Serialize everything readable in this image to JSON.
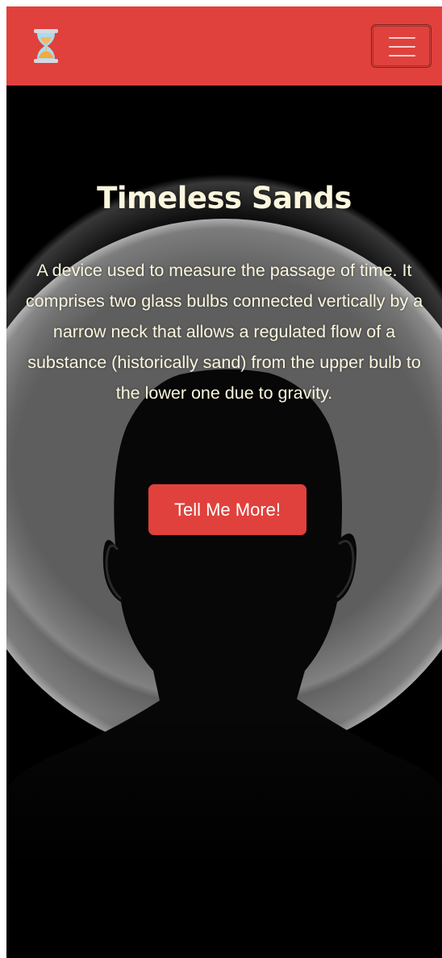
{
  "navbar": {
    "brand_icon": "hourglass-icon",
    "toggler_icon": "hamburger-menu-icon",
    "background_color": "#e0413c"
  },
  "hero": {
    "title": "Timeless Sands",
    "description": "A device used to measure the passage of time. It comprises two glass bulbs connected vertically by a narrow neck that allows a regulated flow of a substance (historically sand) from the upper bulb to the lower one due to gravity.",
    "cta_label": "Tell Me More!",
    "background_image": "silhouette-head-portrait",
    "text_color": "#fbf6dd",
    "accent_color": "#e0413c"
  }
}
